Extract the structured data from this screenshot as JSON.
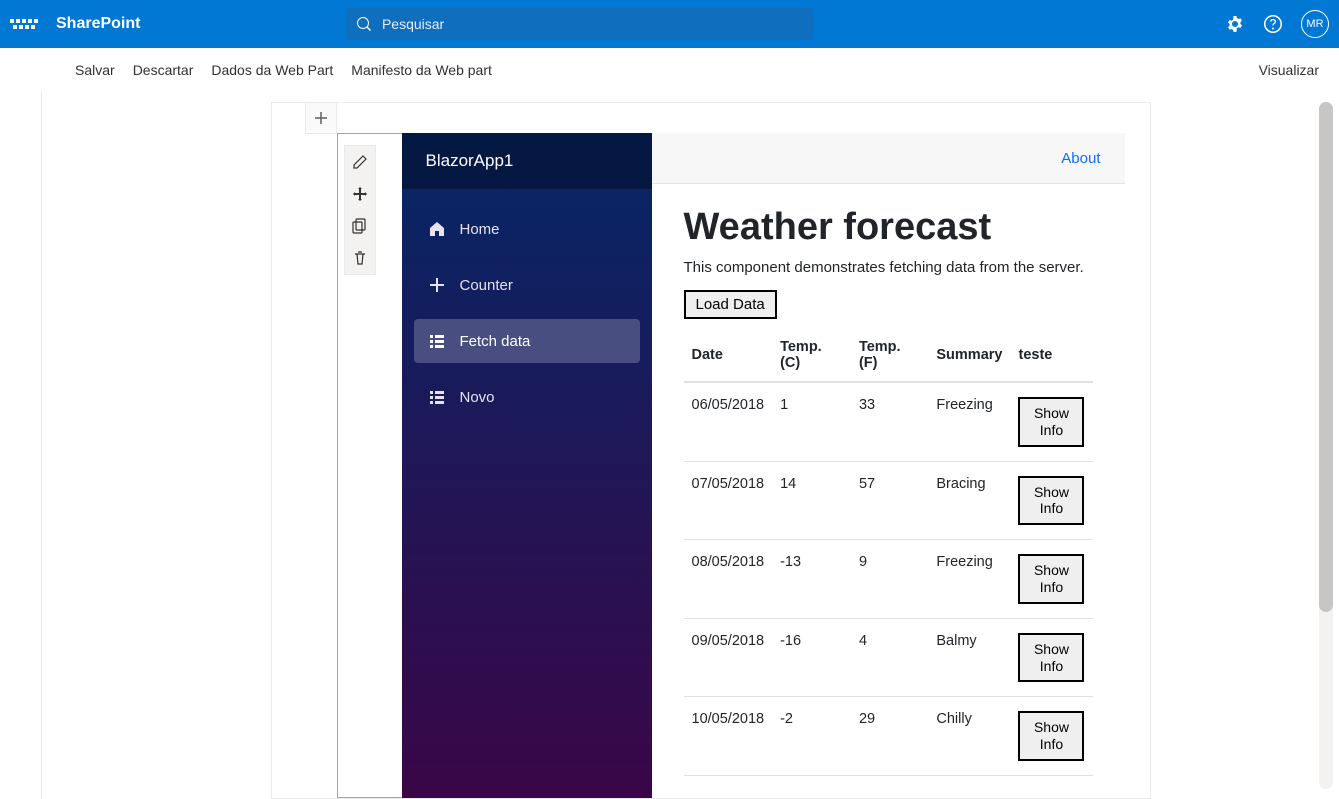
{
  "suite": {
    "title": "SharePoint",
    "search_placeholder": "Pesquisar",
    "avatar_initials": "MR"
  },
  "commands": {
    "save": "Salvar",
    "discard": "Descartar",
    "webpart_data": "Dados da Web Part",
    "webpart_manifest": "Manifesto da Web part",
    "preview": "Visualizar"
  },
  "blazor": {
    "brand": "BlazorApp1",
    "about": "About",
    "nav": {
      "home": "Home",
      "counter": "Counter",
      "fetch": "Fetch data",
      "novo": "Novo"
    },
    "page": {
      "title": "Weather forecast",
      "subtitle": "This component demonstrates fetching data from the server.",
      "load_button": "Load Data",
      "show_info": "Show Info",
      "columns": {
        "date": "Date",
        "tempc": "Temp. (C)",
        "tempf": "Temp. (F)",
        "summary": "Summary",
        "teste": "teste"
      },
      "rows": [
        {
          "date": "06/05/2018",
          "c": "1",
          "f": "33",
          "summary": "Freezing"
        },
        {
          "date": "07/05/2018",
          "c": "14",
          "f": "57",
          "summary": "Bracing"
        },
        {
          "date": "08/05/2018",
          "c": "-13",
          "f": "9",
          "summary": "Freezing"
        },
        {
          "date": "09/05/2018",
          "c": "-16",
          "f": "4",
          "summary": "Balmy"
        },
        {
          "date": "10/05/2018",
          "c": "-2",
          "f": "29",
          "summary": "Chilly"
        }
      ]
    }
  }
}
